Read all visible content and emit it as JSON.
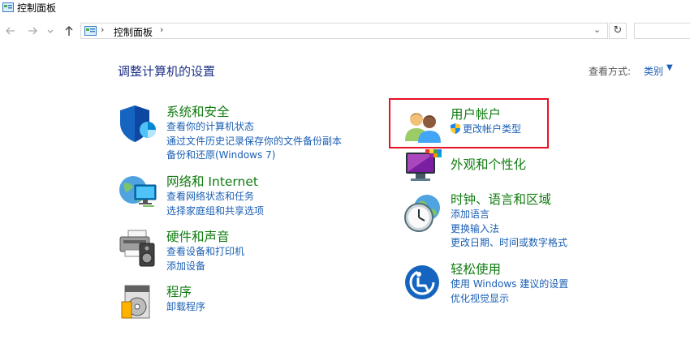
{
  "window": {
    "title": "控制面板"
  },
  "nav": {
    "back_icon": "back-arrow-icon",
    "forward_icon": "forward-arrow-icon",
    "recent_icon": "chevron-down-icon",
    "up_icon": "up-arrow-icon",
    "breadcrumb": [
      "控制面板"
    ],
    "refresh_icon": "refresh-icon"
  },
  "header": {
    "title": "调整计算机的设置",
    "view_by_label": "查看方式:",
    "view_by_value": "类别"
  },
  "categories": {
    "system": {
      "title": "系统和安全",
      "icon": "shield-icon",
      "links": [
        "查看你的计算机状态",
        "通过文件历史记录保存你的文件备份副本",
        "备份和还原(Windows 7)"
      ]
    },
    "network": {
      "title": "网络和 Internet",
      "icon": "network-globe-icon",
      "links": [
        "查看网络状态和任务",
        "选择家庭组和共享选项"
      ]
    },
    "hardware": {
      "title": "硬件和声音",
      "icon": "printer-speaker-icon",
      "links": [
        "查看设备和打印机",
        "添加设备"
      ]
    },
    "programs": {
      "title": "程序",
      "icon": "programs-disc-icon",
      "links": [
        "卸载程序"
      ]
    },
    "users": {
      "title": "用户帐户",
      "icon": "users-icon",
      "links": [
        "更改帐户类型"
      ]
    },
    "appearance": {
      "title": "外观和个性化",
      "icon": "monitor-palette-icon",
      "links": []
    },
    "clock": {
      "title": "时钟、语言和区域",
      "icon": "clock-globe-icon",
      "links": [
        "添加语言",
        "更换输入法",
        "更改日期、时间或数字格式"
      ]
    },
    "ease": {
      "title": "轻松使用",
      "icon": "ease-of-access-icon",
      "links": [
        "使用 Windows 建议的设置",
        "优化视觉显示"
      ]
    }
  },
  "colors": {
    "category_title": "#107c10",
    "link": "#1a5fb4",
    "heading": "#1e3287",
    "highlight_border": "#e81123"
  }
}
